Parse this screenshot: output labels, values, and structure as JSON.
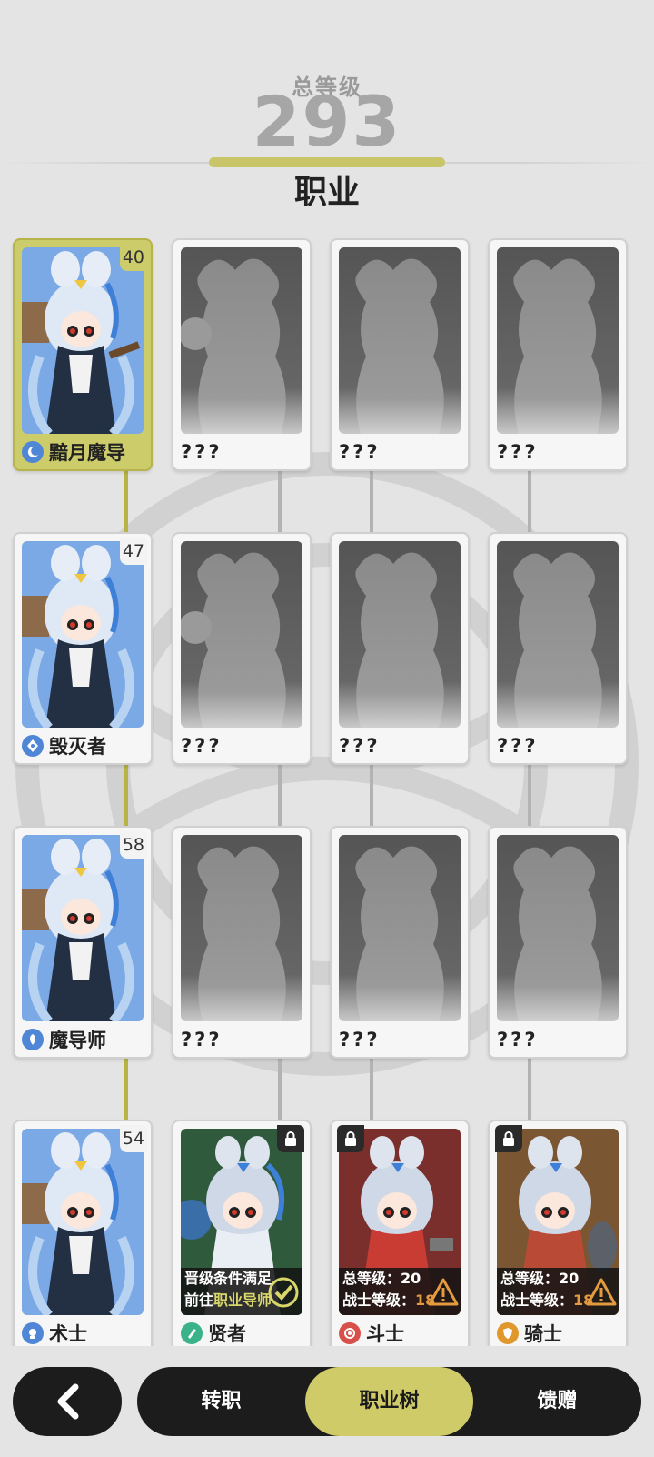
{
  "header": {
    "total_level_label": "总等级",
    "total_level_value": "293",
    "section_title": "职业"
  },
  "grid": {
    "rows": [
      {
        "cards": [
          {
            "name": "黯月魔导",
            "level": "40",
            "state": "selected",
            "icon": "moon-class-icon",
            "icon_color": "#4f86d6"
          },
          {
            "name": "???",
            "state": "unknown"
          },
          {
            "name": "???",
            "state": "unknown"
          },
          {
            "name": "???",
            "state": "unknown"
          }
        ]
      },
      {
        "cards": [
          {
            "name": "毁灭者",
            "level": "47",
            "state": "unlocked",
            "icon": "destroyer-class-icon",
            "icon_color": "#4f86d6"
          },
          {
            "name": "???",
            "state": "unknown"
          },
          {
            "name": "???",
            "state": "unknown"
          },
          {
            "name": "???",
            "state": "unknown"
          }
        ]
      },
      {
        "cards": [
          {
            "name": "魔导师",
            "level": "58",
            "state": "unlocked",
            "icon": "mage-class-icon",
            "icon_color": "#4f86d6"
          },
          {
            "name": "???",
            "state": "unknown"
          },
          {
            "name": "???",
            "state": "unknown"
          },
          {
            "name": "???",
            "state": "unknown"
          }
        ]
      },
      {
        "cards": [
          {
            "name": "术士",
            "level": "54",
            "state": "unlocked",
            "icon": "warlock-class-icon",
            "icon_color": "#4f86d6"
          },
          {
            "name": "贤者",
            "state": "locked",
            "icon": "sage-class-icon",
            "icon_color": "#3bb38a",
            "requirement_line1": "晋级条件满足",
            "requirement_line2_prefix": "前往",
            "requirement_line2_link": "职业导师"
          },
          {
            "name": "斗士",
            "state": "locked",
            "icon": "fighter-class-icon",
            "icon_color": "#d8504a",
            "requirement_line1_label": "总等级：",
            "requirement_line1_value": "20",
            "requirement_line2_label": "战士等级：",
            "requirement_line2_value": "18"
          },
          {
            "name": "骑士",
            "state": "locked",
            "icon": "knight-class-icon",
            "icon_color": "#e0972c",
            "requirement_line1_label": "总等级：",
            "requirement_line1_value": "20",
            "requirement_line2_label": "战士等级：",
            "requirement_line2_value": "18"
          }
        ]
      }
    ]
  },
  "bottom_nav": {
    "back_icon": "chevron-left-icon",
    "tabs": [
      {
        "label": "转职",
        "active": false
      },
      {
        "label": "职业树",
        "active": true
      },
      {
        "label": "馈赠",
        "active": false
      }
    ]
  },
  "colors": {
    "accent": "#cfcb69",
    "background": "#e4e4e4",
    "dark": "#1c1c1c",
    "warning": "#e49a3e"
  }
}
